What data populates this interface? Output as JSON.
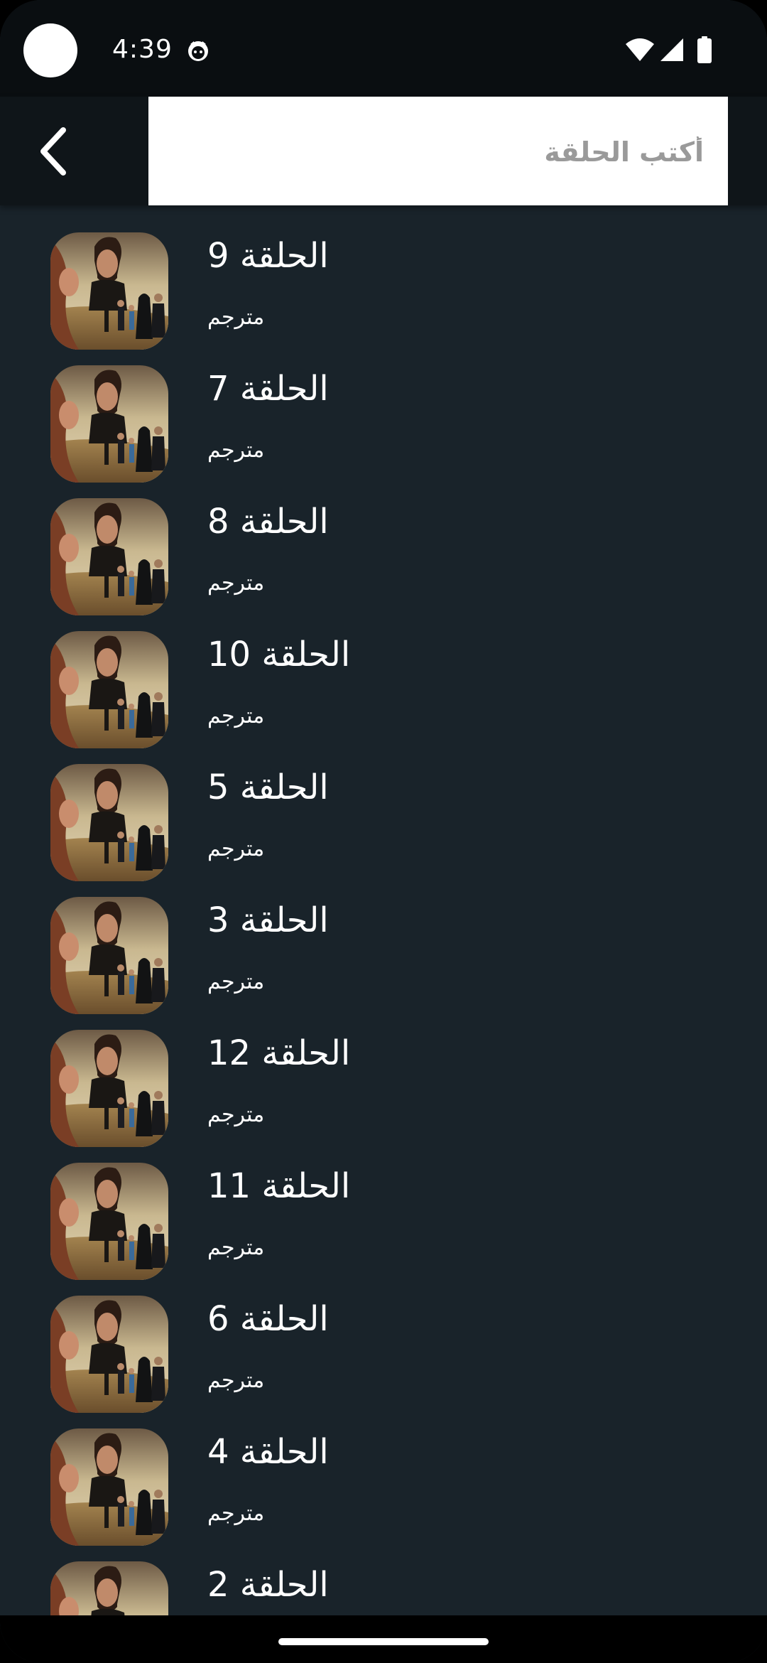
{
  "status_bar": {
    "time": "4:39",
    "icons": [
      "camera-cutout",
      "notification-icon",
      "wifi-icon",
      "signal-icon",
      "battery-icon"
    ]
  },
  "app_bar": {
    "back_icon": "chevron-left-icon",
    "search": {
      "placeholder": "أكتب الحلقة",
      "value": ""
    }
  },
  "episodes": [
    {
      "title": "الحلقة 9",
      "subtitle": "مترجم"
    },
    {
      "title": "الحلقة 7",
      "subtitle": "مترجم"
    },
    {
      "title": "الحلقة 8",
      "subtitle": "مترجم"
    },
    {
      "title": "الحلقة 10",
      "subtitle": "مترجم"
    },
    {
      "title": "الحلقة 5",
      "subtitle": "مترجم"
    },
    {
      "title": "الحلقة 3",
      "subtitle": "مترجم"
    },
    {
      "title": "الحلقة 12",
      "subtitle": "مترجم"
    },
    {
      "title": "الحلقة 11",
      "subtitle": "مترجم"
    },
    {
      "title": "الحلقة 6",
      "subtitle": "مترجم"
    },
    {
      "title": "الحلقة 4",
      "subtitle": "مترجم"
    },
    {
      "title": "الحلقة 2",
      "subtitle": ""
    }
  ],
  "colors": {
    "background": "#19232a",
    "status_bar": "#0a0e11",
    "app_bar": "#0f1519",
    "text": "#ffffff",
    "placeholder": "#9a9a9a"
  }
}
